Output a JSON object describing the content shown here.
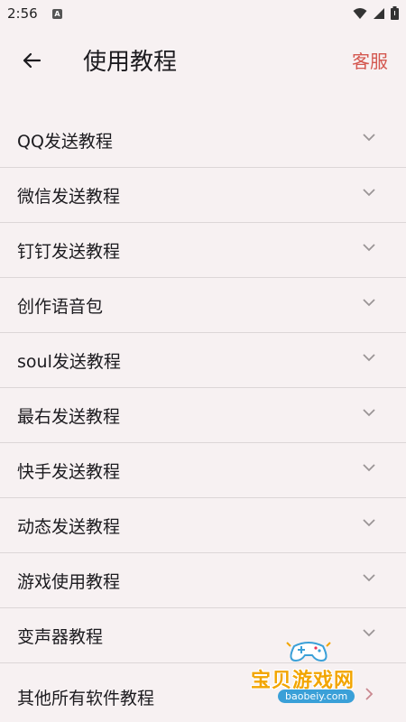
{
  "status_bar": {
    "time": "2:56",
    "notif_glyph": "A"
  },
  "app_bar": {
    "title": "使用教程",
    "service_label": "客服"
  },
  "tutorials": [
    {
      "label": "QQ发送教程"
    },
    {
      "label": "微信发送教程"
    },
    {
      "label": "钉钉发送教程"
    },
    {
      "label": "创作语音包"
    },
    {
      "label": "soul发送教程"
    },
    {
      "label": "最右发送教程"
    },
    {
      "label": "快手发送教程"
    },
    {
      "label": "动态发送教程"
    },
    {
      "label": "游戏使用教程"
    },
    {
      "label": "变声器教程"
    }
  ],
  "partial_item": {
    "label": "其他所有软件教程"
  },
  "watermark": {
    "text": "宝贝游戏网",
    "url": "baobeiy.com"
  },
  "colors": {
    "accent": "#d4574f",
    "background": "#f7f1f2",
    "divider": "#dcd6d7"
  }
}
